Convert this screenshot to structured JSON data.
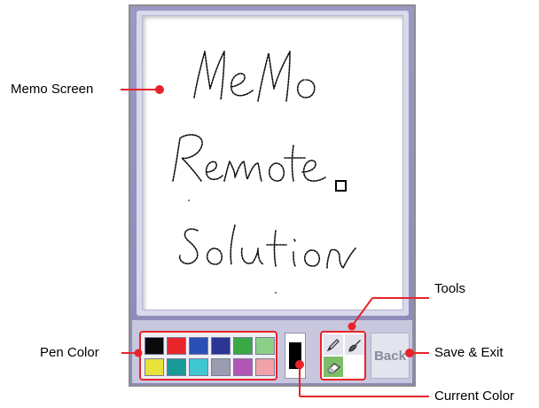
{
  "memo": {
    "handwriting": [
      "MeMo",
      "Remote",
      "Solution"
    ]
  },
  "toolbar": {
    "back_label": "Back",
    "palette_colors": [
      "#0a0a0a",
      "#e8262b",
      "#2a4fb5",
      "#2b3596",
      "#3aa844",
      "#8ccf86",
      "#e8e33a",
      "#1a9a94",
      "#3fc8d2",
      "#9c9cb0",
      "#b256b6",
      "#f1a2a8"
    ],
    "current_color": "#000000",
    "tool_icons": [
      "pencil-icon",
      "brush-icon",
      "eraser-icon",
      "blank-tool"
    ]
  },
  "labels": {
    "memo_screen": "Memo Screen",
    "pen_color": "Pen Color",
    "tools": "Tools",
    "save_exit": "Save & Exit",
    "current_color": "Current Color"
  },
  "colors": {
    "callout": "#e8232a",
    "device": "#9a99c4"
  }
}
